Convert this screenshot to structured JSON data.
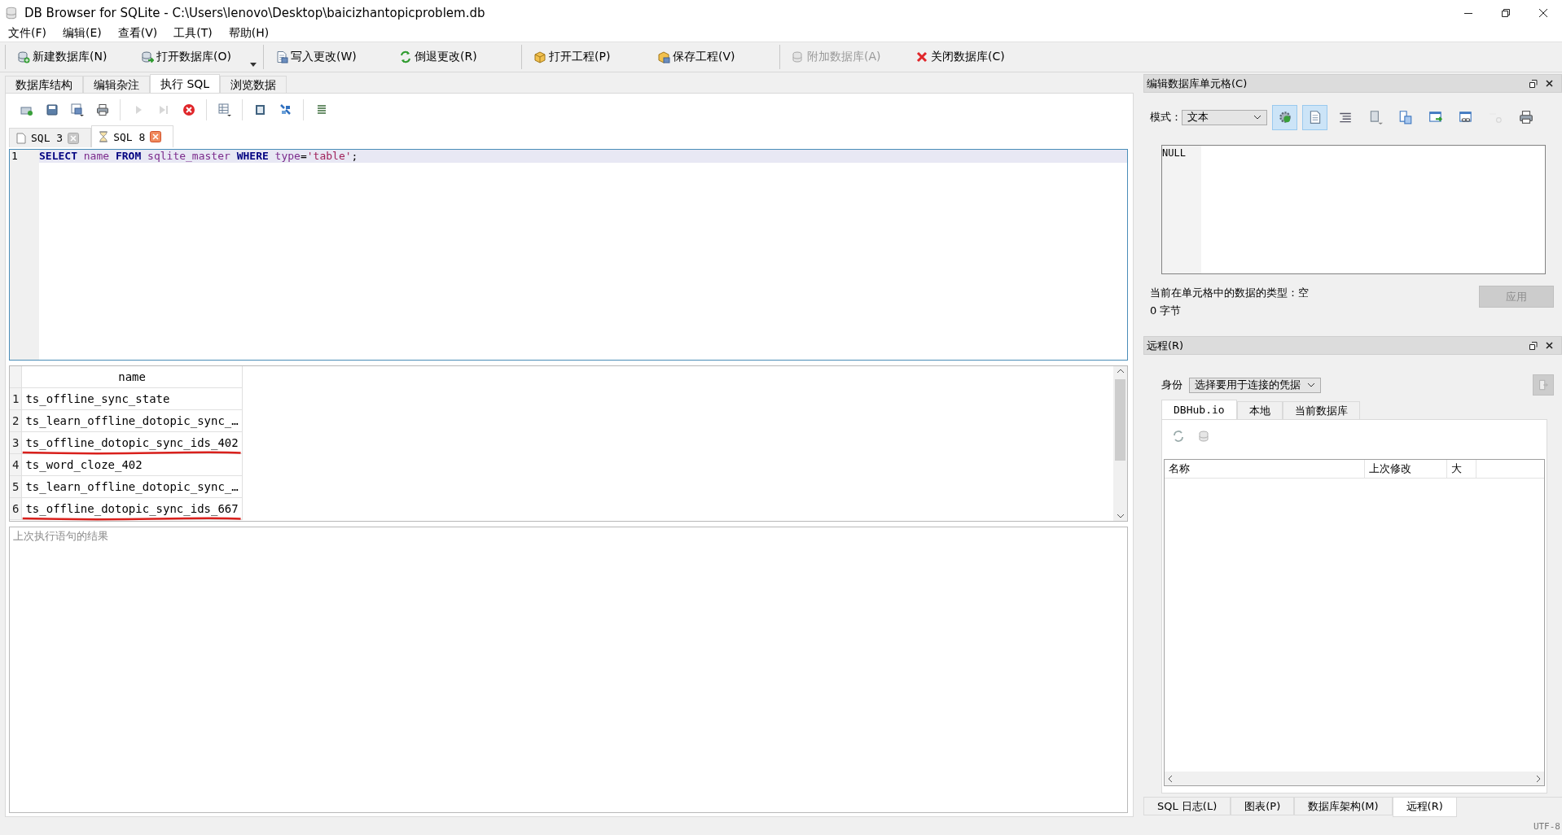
{
  "window": {
    "title": "DB Browser for SQLite - C:\\Users\\lenovo\\Desktop\\baicizhantopicproblem.db"
  },
  "menu": [
    "文件(F)",
    "编辑(E)",
    "查看(V)",
    "工具(T)",
    "帮助(H)"
  ],
  "toolbar_groups": [
    {
      "items": [
        {
          "label": "新建数据库(N)",
          "kind": "db-new",
          "disabled": false,
          "dropdown": false
        },
        {
          "label": "打开数据库(O)",
          "kind": "db-open",
          "disabled": false,
          "dropdown": true
        }
      ]
    },
    {
      "items": [
        {
          "label": "写入更改(W)",
          "kind": "write",
          "disabled": false,
          "dropdown": false
        },
        {
          "label": "倒退更改(R)",
          "kind": "revert",
          "disabled": false,
          "dropdown": false
        }
      ]
    },
    {
      "items": [
        {
          "label": "打开工程(P)",
          "kind": "project-open",
          "disabled": false,
          "dropdown": false
        },
        {
          "label": "保存工程(V)",
          "kind": "project-save",
          "disabled": false,
          "dropdown": false
        }
      ]
    },
    {
      "items": [
        {
          "label": "附加数据库(A)",
          "kind": "db-attach",
          "disabled": true,
          "dropdown": false
        },
        {
          "label": "关闭数据库(C)",
          "kind": "db-close",
          "disabled": false,
          "dropdown": false
        }
      ]
    }
  ],
  "main_tabs": [
    {
      "label": "数据库结构",
      "selected": false
    },
    {
      "label": "编辑杂注",
      "selected": false
    },
    {
      "label": "执行 SQL",
      "selected": true
    },
    {
      "label": "浏览数据",
      "selected": false
    }
  ],
  "sql_toolbar": [
    {
      "items": [
        {
          "kind": "open-tab",
          "disabled": false
        },
        {
          "kind": "save",
          "disabled": false
        },
        {
          "kind": "save-menu",
          "disabled": false
        },
        {
          "kind": "print",
          "disabled": false
        }
      ]
    },
    {
      "items": [
        {
          "kind": "run",
          "disabled": true
        },
        {
          "kind": "run-line",
          "disabled": true
        },
        {
          "kind": "stop",
          "disabled": false
        }
      ]
    },
    {
      "items": [
        {
          "kind": "save-results",
          "disabled": false
        }
      ]
    },
    {
      "items": [
        {
          "kind": "find",
          "disabled": false
        },
        {
          "kind": "replace",
          "disabled": false
        }
      ]
    },
    {
      "items": [
        {
          "kind": "comment",
          "disabled": false
        }
      ]
    }
  ],
  "sql_tabs": [
    {
      "label": "SQL 3",
      "kind": "page",
      "selected": false
    },
    {
      "label": "SQL 8",
      "kind": "running",
      "selected": true
    }
  ],
  "editor": {
    "lines": [
      {
        "number": "1",
        "tokens": [
          {
            "text": "SELECT",
            "kind": "keyword"
          },
          {
            "text": " name ",
            "kind": "identifier"
          },
          {
            "text": "FROM",
            "kind": "keyword"
          },
          {
            "text": " sqlite_master ",
            "kind": "identifier"
          },
          {
            "text": "WHERE",
            "kind": "keyword"
          },
          {
            "text": " type",
            "kind": "identifier"
          },
          {
            "text": "=",
            "kind": "operator"
          },
          {
            "text": "'table'",
            "kind": "string"
          },
          {
            "text": ";",
            "kind": "operator"
          }
        ]
      }
    ]
  },
  "results": {
    "columns": [
      "name"
    ],
    "rows": [
      {
        "number": "1",
        "cells": [
          "ts_offline_sync_state"
        ],
        "marked": false
      },
      {
        "number": "2",
        "cells": [
          "ts_learn_offline_dotopic_sync_…"
        ],
        "marked": false
      },
      {
        "number": "3",
        "cells": [
          "ts_offline_dotopic_sync_ids_402"
        ],
        "marked": true
      },
      {
        "number": "4",
        "cells": [
          "ts_word_cloze_402"
        ],
        "marked": false
      },
      {
        "number": "5",
        "cells": [
          "ts_learn_offline_dotopic_sync_…"
        ],
        "marked": false
      },
      {
        "number": "6",
        "cells": [
          "ts_offline_dotopic_sync_ids_667"
        ],
        "marked": true
      }
    ]
  },
  "message": {
    "placeholder": "上次执行语句的结果"
  },
  "cell_editor": {
    "title": "编辑数据库单元格(C)",
    "mode_label": "模式：",
    "mode": "文本",
    "tools": [
      {
        "kind": "auto-switch",
        "checked": true,
        "disabled": false
      },
      {
        "kind": "text",
        "checked": true,
        "disabled": false
      },
      {
        "kind": "wrap",
        "checked": false,
        "disabled": false
      },
      {
        "kind": "import",
        "checked": false,
        "disabled": false
      },
      {
        "kind": "export",
        "checked": false,
        "disabled": false
      },
      {
        "kind": "open-external",
        "checked": false,
        "disabled": false
      },
      {
        "kind": "link",
        "checked": false,
        "disabled": false
      },
      {
        "kind": "set-null",
        "checked": false,
        "disabled": true
      },
      {
        "kind": "print",
        "checked": false,
        "disabled": false
      }
    ],
    "value": "NULL",
    "type_info": "当前在单元格中的数据的类型：空",
    "size": "0 字节",
    "apply": {
      "label": "应用",
      "disabled": true
    }
  },
  "remote": {
    "title": "远程(R)",
    "identity_label": "身份",
    "identity": "选择要用于连接的凭据",
    "tabs": [
      {
        "label": "DBHub.io",
        "selected": true
      },
      {
        "label": "本地",
        "selected": false
      },
      {
        "label": "当前数据库",
        "selected": false
      }
    ],
    "columns": [
      "名称",
      "上次修改",
      "大"
    ]
  },
  "bottom_tabs": [
    {
      "label": "SQL 日志(L)",
      "selected": false
    },
    {
      "label": "图表(P)",
      "selected": false
    },
    {
      "label": "数据库架构(M)",
      "selected": false
    },
    {
      "label": "远程(R)",
      "selected": true
    }
  ],
  "status": {
    "encoding": "UTF-8"
  }
}
